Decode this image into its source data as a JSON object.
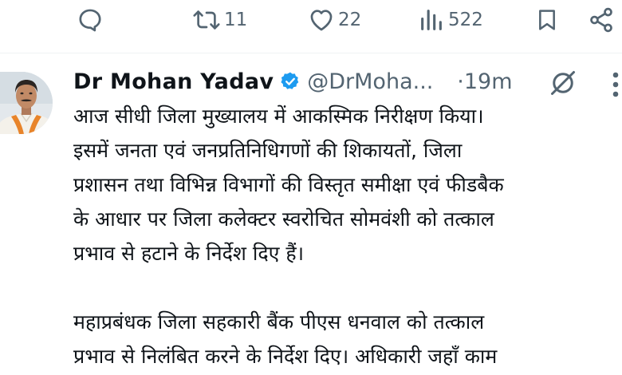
{
  "actions": {
    "repost_count": "11",
    "like_count": "22",
    "view_count": "522"
  },
  "tweet": {
    "author_name": "Dr Mohan Yadav",
    "handle": "@DrMoha...",
    "time": "·19m",
    "lines_para1": [
      "आज सीधी जिला मुख्यालय में आकस्मिक निरीक्षण किया।",
      "इसमें जनता एवं जनप्रतिनिधिगणों की शिकायतों, जिला",
      "प्रशासन तथा विभिन्न विभागों की विस्तृत समीक्षा एवं फीडबैक",
      "के आधार पर जिला कलेक्टर स्वरोचित सोमवंशी को तत्काल",
      "प्रभाव से हटाने के निर्देश दिए हैं।"
    ],
    "lines_para2": [
      "महाप्रबंधक जिला सहकारी बैंक पीएस धनवाल को तत्काल",
      "प्रभाव से निलंबित करने के निर्देश दिए। अधिकारी जहाँ काम"
    ]
  },
  "colors": {
    "text": "#0f1419",
    "muted": "#536471",
    "verified": "#1d9bf0",
    "divider": "#eff3f4"
  },
  "icons": {
    "reply": "reply-icon",
    "repost": "repost-icon",
    "like": "heart-icon",
    "views": "views-icon",
    "bookmark": "bookmark-icon",
    "share": "share-icon",
    "verified": "verified-badge-icon",
    "grok": "grok-icon",
    "more": "more-icon"
  }
}
